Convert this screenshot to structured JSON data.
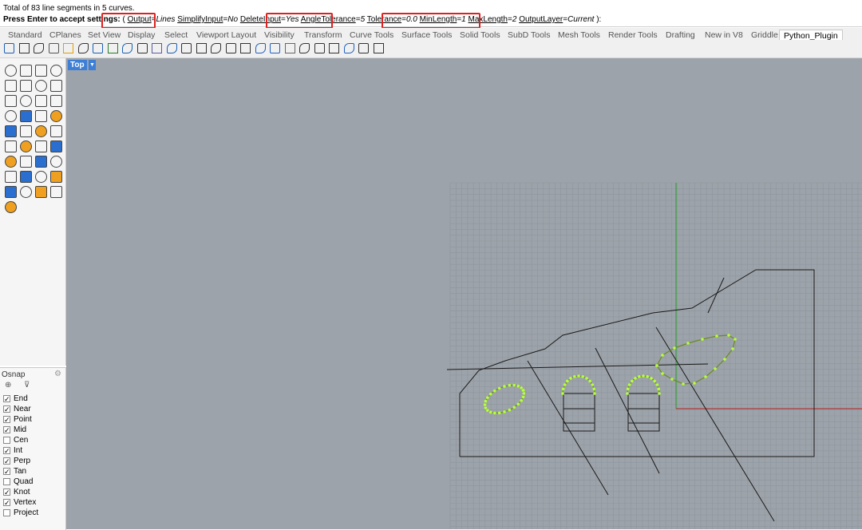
{
  "command": {
    "history": "Total of 83 line segments in 5 curves.",
    "prompt_label": "Press Enter to accept settings",
    "opt_open": "( ",
    "output_key": "Output",
    "output_val": "Lines",
    "simplify_key": "SimplifyInput",
    "simplify_val": "No",
    "delete_key": "DeleteInput",
    "delete_val": "Yes",
    "angle_key": "AngleTolerance",
    "angle_val": "5",
    "tolerance_key": "Tolerance",
    "tolerance_val": "0.0",
    "minlen_key": "MinLength",
    "minlen_val": "1",
    "maxlen_key": "MaxLength",
    "maxlen_val": "2",
    "outlayer_key": "OutputLayer",
    "outlayer_val": "Current",
    "opt_close": " ):"
  },
  "tabs": [
    "Standard",
    "CPlanes",
    "Set View",
    "Display",
    "Select",
    "Viewport Layout",
    "Visibility",
    "Transform",
    "Curve Tools",
    "Surface Tools",
    "Solid Tools",
    "SubD Tools",
    "Mesh Tools",
    "Render Tools",
    "Drafting",
    "New in V8",
    "Griddle",
    "Python_Plugin"
  ],
  "active_tab": "Python_Plugin",
  "osnap": {
    "title": "Osnap",
    "items": [
      {
        "label": "End",
        "checked": true
      },
      {
        "label": "Near",
        "checked": true
      },
      {
        "label": "Point",
        "checked": true
      },
      {
        "label": "Mid",
        "checked": true
      },
      {
        "label": "Cen",
        "checked": false
      },
      {
        "label": "Int",
        "checked": true
      },
      {
        "label": "Perp",
        "checked": true
      },
      {
        "label": "Tan",
        "checked": true
      },
      {
        "label": "Quad",
        "checked": false
      },
      {
        "label": "Knot",
        "checked": true
      },
      {
        "label": "Vertex",
        "checked": true
      },
      {
        "label": "Project",
        "checked": false
      }
    ]
  },
  "viewport": {
    "name": "Top"
  },
  "colors": {
    "viewport_bg": "#9da3aa",
    "grid_line": "#8e959c",
    "axis_x": "#b02020",
    "axis_y": "#20a020",
    "highlight_points": "#b6ff3a",
    "highlight_box": "#e02020",
    "active_viewport_tab": "#3d7fd6"
  }
}
